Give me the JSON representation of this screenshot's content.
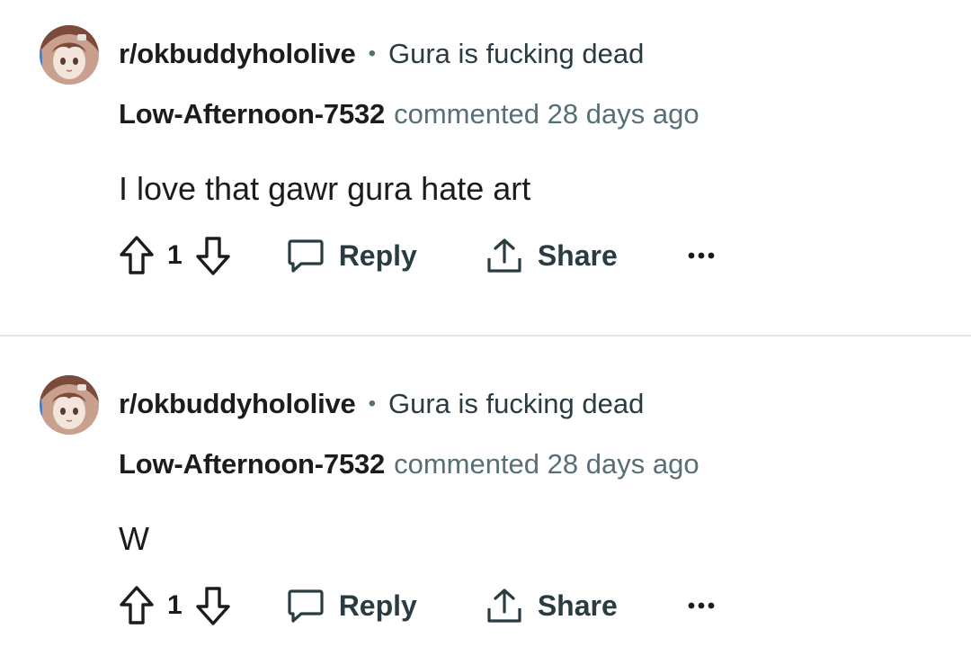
{
  "comments": [
    {
      "subreddit": "r/okbuddyhololive",
      "separator": "•",
      "post_title": "Gura is fucking dead",
      "username": "Low-Afternoon-7532",
      "meta": "commented 28 days ago",
      "body": "I love that gawr gura hate art",
      "votes": "1",
      "reply_label": "Reply",
      "share_label": "Share"
    },
    {
      "subreddit": "r/okbuddyhololive",
      "separator": "•",
      "post_title": "Gura is fucking dead",
      "username": "Low-Afternoon-7532",
      "meta": "commented 28 days ago",
      "body": "W",
      "votes": "1",
      "reply_label": "Reply",
      "share_label": "Share"
    }
  ],
  "colors": {
    "text_primary": "#1c1c1c",
    "text_secondary": "#576f76",
    "divider": "#e4e6e8"
  },
  "icons": [
    "avatar",
    "upvote-icon",
    "downvote-icon",
    "comment-bubble-icon",
    "share-icon",
    "more-options-icon"
  ]
}
